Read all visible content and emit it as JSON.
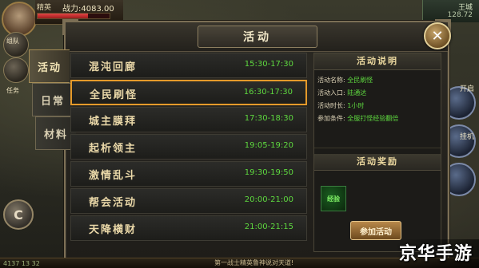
{
  "hud": {
    "player_name": "精英",
    "power_label": "战力:4083.00",
    "hp_level": 0.7,
    "right_line1": "王城",
    "right_line2": "128.72"
  },
  "left_side": {
    "label1": "组队",
    "label2": "任务",
    "c_button": "C"
  },
  "right_side": {
    "label_open": "开启",
    "label_skill": "挂机"
  },
  "dialog": {
    "title": "活动",
    "close_label": "✕"
  },
  "tabs": [
    {
      "label": "活动",
      "active": true
    },
    {
      "label": "日常",
      "active": false
    },
    {
      "label": "材料",
      "active": false
    }
  ],
  "events": [
    {
      "name": "混沌回廊",
      "time": "15:30-17:30",
      "selected": false
    },
    {
      "name": "全民刷怪",
      "time": "16:30-17:30",
      "selected": true
    },
    {
      "name": "城主膜拜",
      "time": "17:30-18:30",
      "selected": false
    },
    {
      "name": "起析领主",
      "time": "19:05-19:20",
      "selected": false
    },
    {
      "name": "激情乱斗",
      "time": "19:30-19:50",
      "selected": false
    },
    {
      "name": "帮会活动",
      "time": "20:00-21:00",
      "selected": false
    },
    {
      "name": "天降横财",
      "time": "21:00-21:15",
      "selected": false
    }
  ],
  "panel": {
    "desc_title": "活动说明",
    "rows": [
      {
        "label": "活动名称:",
        "value": "全民刷怪"
      },
      {
        "label": "活动入口:",
        "value": "陆通达"
      },
      {
        "label": "活动时长:",
        "value": "1小时"
      },
      {
        "label": "参加条件:",
        "value": "全服打怪经验翻倍"
      }
    ],
    "reward_title": "活动奖励",
    "reward_icon_label": "经验",
    "join_button": "参加活动"
  },
  "bottom": {
    "center_text": "第一战士精英鲁神说对天道!",
    "left_text": "4137 13 32"
  },
  "watermark": "京华手游"
}
